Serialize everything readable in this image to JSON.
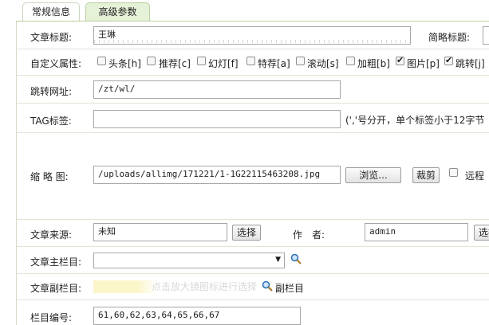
{
  "tabs": {
    "general": "常规信息",
    "advanced": "高级参数"
  },
  "form": {
    "title_label": "文章标题:",
    "title_value": "王琳",
    "short_title_label": "简略标题:",
    "custom_attr_label": "自定义属性:",
    "attributes": [
      {
        "label": "头条[h]",
        "checked": false
      },
      {
        "label": "推荐[c]",
        "checked": false
      },
      {
        "label": "幻灯[f]",
        "checked": false
      },
      {
        "label": "特荐[a]",
        "checked": false
      },
      {
        "label": "滚动[s]",
        "checked": false
      },
      {
        "label": "加粗[b]",
        "checked": false
      },
      {
        "label": "图片[p]",
        "checked": true
      },
      {
        "label": "跳转[j]",
        "checked": true
      }
    ],
    "redirect_label": "跳转网址:",
    "redirect_value": "/zt/wl/",
    "tag_label": "TAG标签:",
    "tag_value": "",
    "tag_hint": "(','号分开，单个标签小于12字节",
    "thumb_label": "缩 略 图:",
    "thumb_value": "/uploads/allimg/171221/1-1G22115463208.jpg",
    "browse_button": "浏览...",
    "crop_button": "裁剪",
    "remote_label": "远程",
    "source_label": "文章来源:",
    "source_value": "未知",
    "source_select_button": "选择",
    "author_label": "作　者:",
    "author_value": "admin",
    "author_select_button": "选择",
    "main_column_label": "文章主栏目:",
    "main_column_value": "",
    "sub_column_label": "文章副栏目:",
    "sub_column_hint": "点击放大镜图标进行选择",
    "sub_column_link": "副栏目",
    "column_ids_label": "栏目编号:",
    "column_ids_value": "61,60,62,63,64,65,66,67"
  }
}
